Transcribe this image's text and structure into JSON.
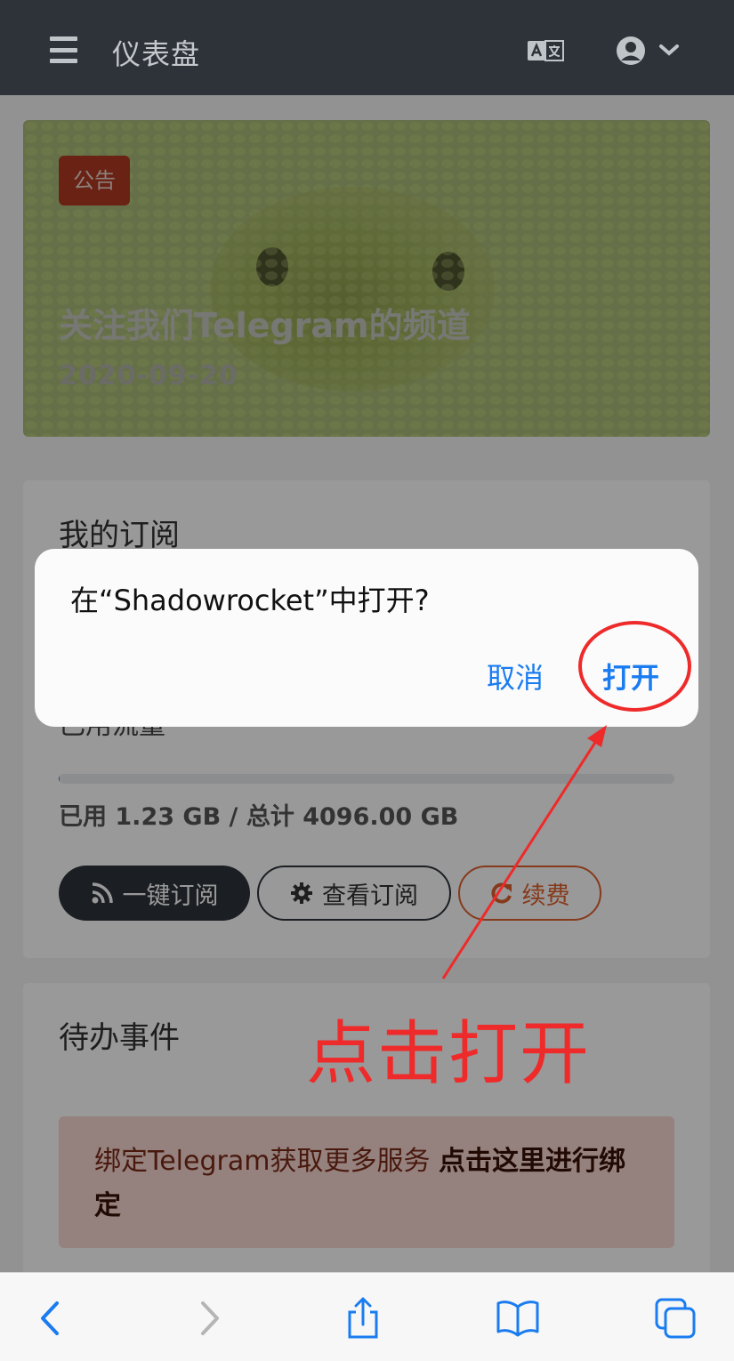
{
  "header": {
    "title": "仪表盘",
    "icons": [
      "menu-icon",
      "translate-icon",
      "user-circle-icon",
      "chevron-down-icon"
    ]
  },
  "announcement": {
    "badge": "公告",
    "title": "关注我们Telegram的频道",
    "date": "2020-09-20"
  },
  "subscription": {
    "title": "我的订阅",
    "partially_hidden_text": "已用流量",
    "usage_text": "已用 1.23 GB / 总计 4096.00 GB",
    "usage_fraction": 0.0003,
    "buttons": {
      "one_click": "一键订阅",
      "view": "查看订阅",
      "renew": "续费"
    }
  },
  "todo": {
    "title": "待办事件",
    "alert_text": "绑定Telegram获取更多服务",
    "alert_link": "点击这里进行绑定"
  },
  "dialog": {
    "message": "在“Shadowrocket”中打开?",
    "cancel": "取消",
    "open": "打开"
  },
  "annotation": {
    "label": "点击打开",
    "color": "#ee2a2a"
  },
  "toolbar": {
    "icons": [
      "back-icon",
      "forward-icon",
      "share-icon",
      "bookmarks-icon",
      "tabs-icon"
    ]
  },
  "colors": {
    "header_bg": "#2e3339",
    "link_blue": "#1a7cf0",
    "renew_orange": "#e0622e",
    "badge_red": "#b03a22"
  }
}
